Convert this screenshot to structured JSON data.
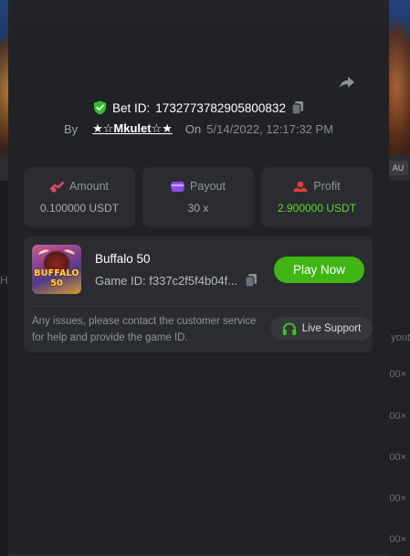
{
  "background": {
    "tag": "AU",
    "side_label": "yout",
    "left_label": "H",
    "multipliers": [
      "00×",
      "00×",
      "00×",
      "00×",
      "00×"
    ]
  },
  "modal": {
    "bet_label": "Bet ID:",
    "bet_id": "1732773782905800832",
    "by_label": "By",
    "username": "★☆Mkulet☆★",
    "on_label": "On",
    "date": "5/14/2022, 12:17:32 PM"
  },
  "stats": {
    "amount": {
      "label": "Amount",
      "value": "0.100000 USDT"
    },
    "payout": {
      "label": "Payout",
      "value": "30 x"
    },
    "profit": {
      "label": "Profit",
      "value": "2.900000 USDT"
    }
  },
  "game": {
    "thumb_text": "BUFFALO 50",
    "name": "Buffalo 50",
    "id_label": "Game ID:",
    "id_value": "f337c2f5f4b04f...",
    "play_label": "Play Now",
    "issue_text": "Any issues, please contact the customer service for help and provide the game ID.",
    "support_label": "Live Support"
  },
  "colors": {
    "accent_green": "#3fb613",
    "profit_green": "#5fd630",
    "modal_bg": "#212226",
    "box_bg": "#2a2c30",
    "shield_green": "#2fc22a"
  }
}
